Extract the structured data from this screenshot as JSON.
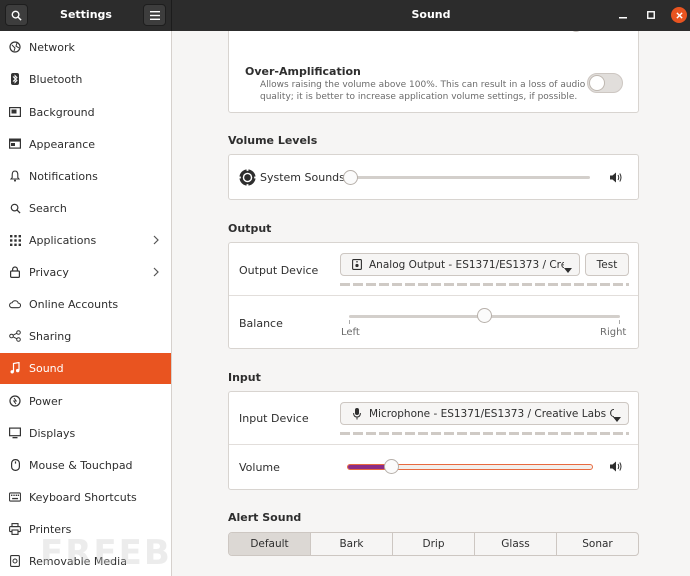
{
  "header": {
    "sidebar_title": "Settings",
    "page_title": "Sound"
  },
  "sidebar": {
    "items": [
      {
        "label": "Network",
        "icon": "network-icon"
      },
      {
        "label": "Bluetooth",
        "icon": "bluetooth-icon"
      },
      {
        "label": "Background",
        "icon": "background-icon"
      },
      {
        "label": "Appearance",
        "icon": "appearance-icon"
      },
      {
        "label": "Notifications",
        "icon": "bell-icon"
      },
      {
        "label": "Search",
        "icon": "search-icon"
      },
      {
        "label": "Applications",
        "icon": "grid-icon"
      },
      {
        "label": "Privacy",
        "icon": "lock-icon"
      },
      {
        "label": "Online Accounts",
        "icon": "cloud-icon"
      },
      {
        "label": "Sharing",
        "icon": "share-icon"
      },
      {
        "label": "Sound",
        "icon": "music-note-icon"
      },
      {
        "label": "Power",
        "icon": "power-icon"
      },
      {
        "label": "Displays",
        "icon": "display-icon"
      },
      {
        "label": "Mouse & Touchpad",
        "icon": "mouse-icon"
      },
      {
        "label": "Keyboard Shortcuts",
        "icon": "keyboard-icon"
      },
      {
        "label": "Printers",
        "icon": "printer-icon"
      },
      {
        "label": "Removable Media",
        "icon": "media-icon"
      }
    ],
    "active": "Sound",
    "accent": "#e95420"
  },
  "over_amplification": {
    "title": "Over-Amplification",
    "description_line1": "Allows raising the volume above 100%. This can result in a loss of audio",
    "description_line2": "quality; it is better to increase application volume settings, if possible.",
    "enabled": false
  },
  "volume_levels": {
    "title": "Volume Levels",
    "system_sounds_label": "System Sounds",
    "system_sounds_level": 0
  },
  "output": {
    "title": "Output",
    "device_label": "Output Device",
    "device_value": "Analog Output - ES1371/ES1373 / Crea...",
    "test_label": "Test",
    "balance_label": "Balance",
    "balance_left": "Left",
    "balance_right": "Right",
    "balance_value": 0.5
  },
  "input": {
    "title": "Input",
    "device_label": "Input Device",
    "device_value": "Microphone - ES1371/ES1373 / Creative Labs CT...",
    "volume_label": "Volume",
    "volume_level": 0.18
  },
  "alert_sound": {
    "title": "Alert Sound",
    "options": [
      "Default",
      "Bark",
      "Drip",
      "Glass",
      "Sonar"
    ],
    "selected": "Default"
  },
  "watermark": "FREEBUF"
}
